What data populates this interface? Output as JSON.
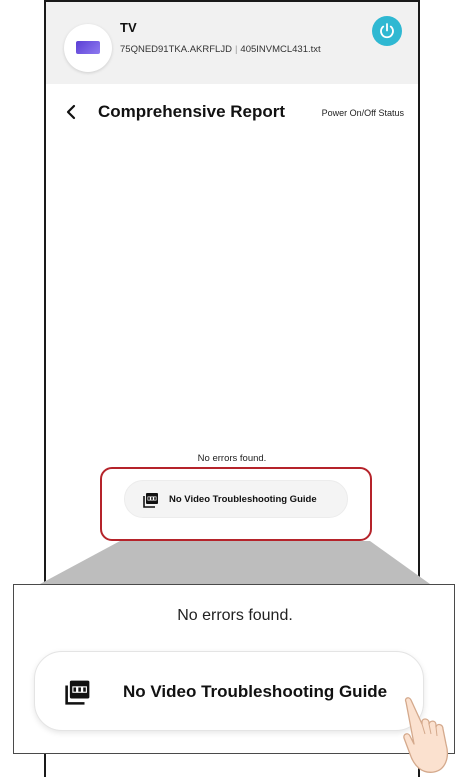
{
  "device": {
    "name": "TV",
    "model": "75QNED91TKA.AKRFLJD",
    "file": "405INVMCL431.txt",
    "separator": "|"
  },
  "screen": {
    "title": "Comprehensive Report",
    "status_link": "Power On/Off Status"
  },
  "report": {
    "message": "No errors found.",
    "guide_button": "No Video Troubleshooting Guide"
  },
  "zoom": {
    "message": "No errors found.",
    "guide_button": "No Video Troubleshooting Guide"
  },
  "colors": {
    "power_button": "#2fb8d2",
    "highlight": "#b5232a",
    "tv_icon": "#6a4fe0"
  },
  "icons": [
    "tv-icon",
    "power-icon",
    "back-chevron-icon",
    "pdf-icon",
    "pointing-hand-icon"
  ]
}
